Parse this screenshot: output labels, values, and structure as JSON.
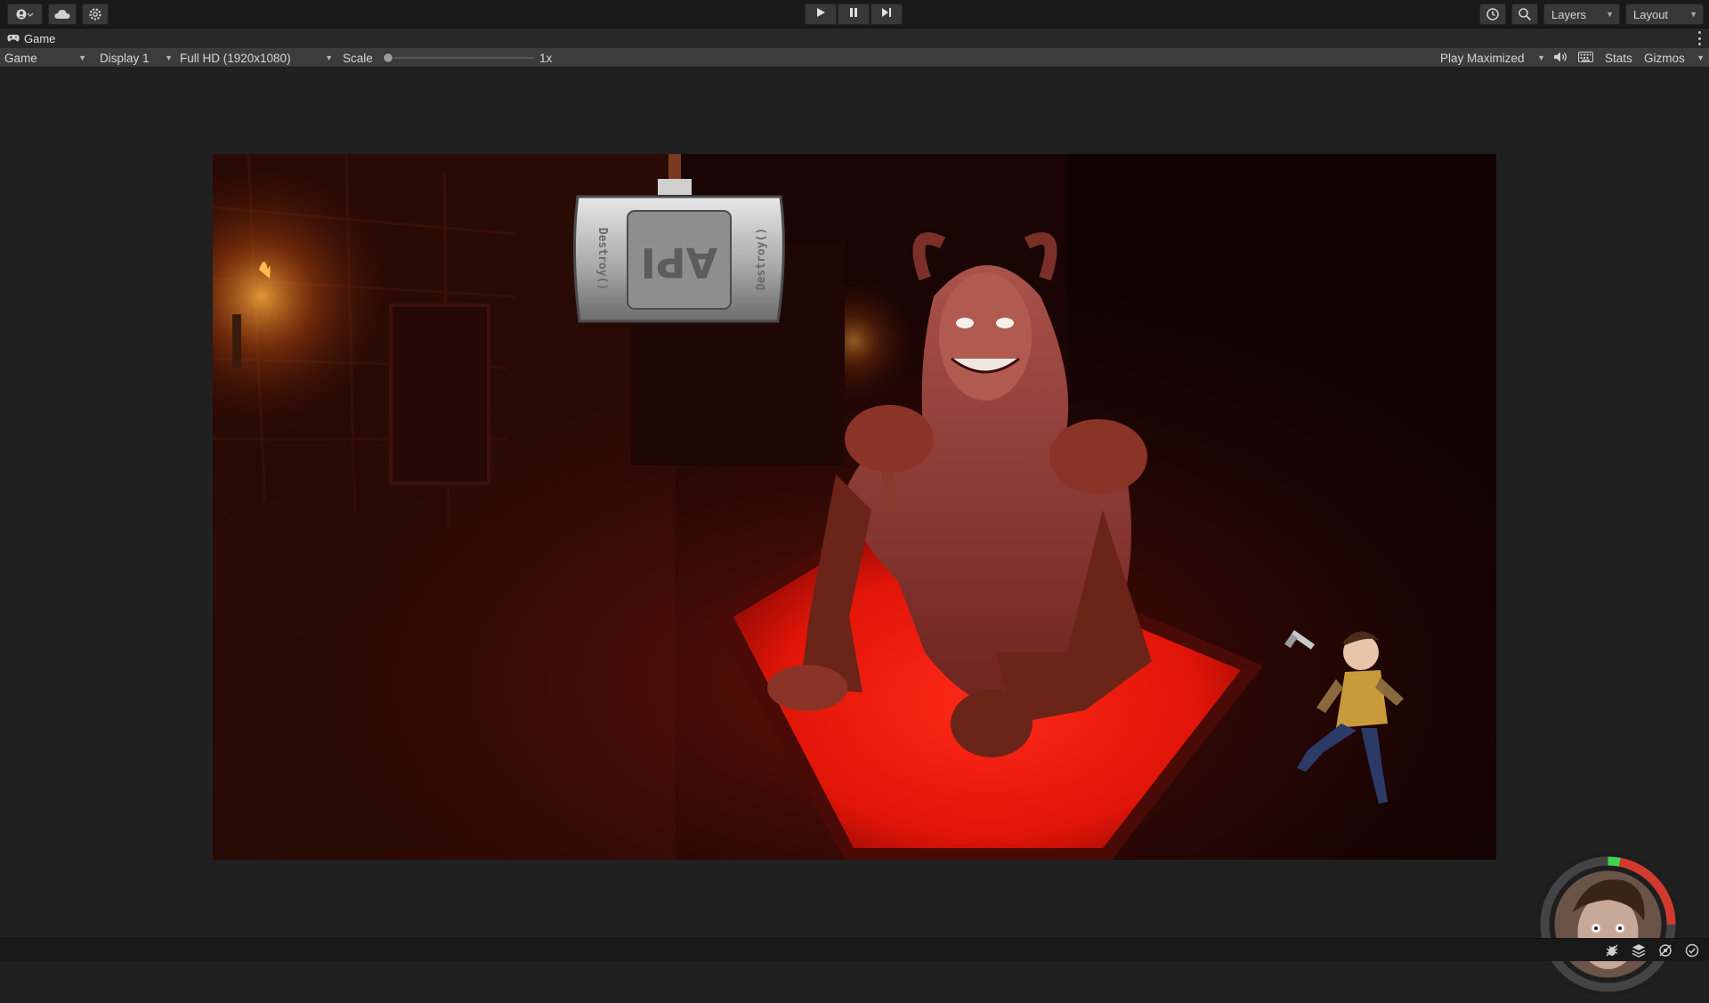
{
  "toolbar": {
    "account_icon": "account-icon",
    "cloud_icon": "cloud-icon",
    "services_icon": "settings-gear-icon",
    "play_controls": [
      "play-icon",
      "pause-icon",
      "step-icon"
    ],
    "history_icon": "history-icon",
    "search_icon": "search-icon",
    "layers_label": "Layers",
    "layout_label": "Layout"
  },
  "tab": {
    "icon": "gamepad-icon",
    "label": "Game"
  },
  "control_bar": {
    "view_select": "Game",
    "display_select": "Display 1",
    "resolution_select": "Full HD (1920x1080)",
    "scale_label": "Scale",
    "scale_value_label": "1x",
    "scale_value": 0,
    "play_mode_select": "Play Maximized",
    "audio_icon": "speaker-icon",
    "aspect_icon": "keyboard-icon",
    "stats_label": "Stats",
    "gizmos_label": "Gizmos"
  },
  "game": {
    "hammer_face_text": "API",
    "hammer_side_text_left": "Destroy()",
    "hammer_side_text_right": "Destroy()",
    "hud": {
      "meter_green_fraction": 0.03,
      "meter_red_fraction": 0.22,
      "accent_green": "#3fd44a",
      "accent_red": "#d23a30"
    }
  },
  "statusbar": {
    "icons": [
      "bug-icon",
      "layers-stack-icon",
      "network-icon",
      "check-circle-icon"
    ]
  },
  "colors": {
    "editor_bg": "#202020",
    "toolbar_bg": "#191919",
    "controlbar_bg": "#3c3c3c",
    "table_glow": "#ff1a10"
  }
}
